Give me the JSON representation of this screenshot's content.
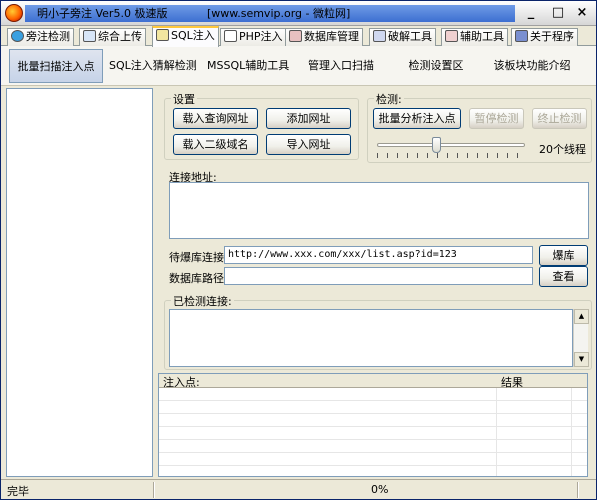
{
  "window": {
    "title_left": "明小子旁注 Ver5.0 极速版",
    "title_right": "[www.semvip.org - 微粒网]",
    "minimize": "_",
    "maximize": "□",
    "close": "×"
  },
  "tabs": [
    {
      "label": "旁注检测",
      "icon": "globe-icon",
      "active": false
    },
    {
      "label": "综合上传",
      "icon": "upload-icon",
      "active": false
    },
    {
      "label": "SQL注入",
      "icon": "sql-icon",
      "active": true
    },
    {
      "label": "PHP注入",
      "icon": "php-icon",
      "active": false
    },
    {
      "label": "数据库管理",
      "icon": "database-icon",
      "active": false
    },
    {
      "label": "破解工具",
      "icon": "crack-icon",
      "active": false
    },
    {
      "label": "辅助工具",
      "icon": "tools-icon",
      "active": false
    },
    {
      "label": "关于程序",
      "icon": "about-icon",
      "active": false
    }
  ],
  "subnav": [
    {
      "label": "批量扫描注入点",
      "active": true
    },
    {
      "label": "SQL注入猜解检测",
      "active": false
    },
    {
      "label": "MSSQL辅助工具",
      "active": false
    },
    {
      "label": "管理入口扫描",
      "active": false
    },
    {
      "label": "检测设置区",
      "active": false
    },
    {
      "label": "该板块功能介绍",
      "active": false
    }
  ],
  "settings": {
    "group_label": "设置",
    "load_query_url": "载入查询网址",
    "add_url": "添加网址",
    "load_subdomain": "载入二级域名",
    "import_url": "导入网址"
  },
  "detect": {
    "group_label": "检测:",
    "batch_analyze": "批量分析注入点",
    "pause_detect": "暂停检测",
    "stop_detect": "终止检测",
    "threads_label": "20个线程",
    "threads_value": 20
  },
  "connection": {
    "label": "连接地址:",
    "value": ""
  },
  "explode": {
    "label": "待爆库连接",
    "value": "http://www.xxx.com/xxx/list.asp?id=123",
    "button": "爆库"
  },
  "dbpath": {
    "label": "数据库路径",
    "value": "",
    "button": "查看"
  },
  "detected": {
    "label": "已检测连接:"
  },
  "results": {
    "columns": [
      "注入点:",
      "结果"
    ],
    "rows": []
  },
  "status": {
    "left": "完毕",
    "progress": "0%"
  }
}
